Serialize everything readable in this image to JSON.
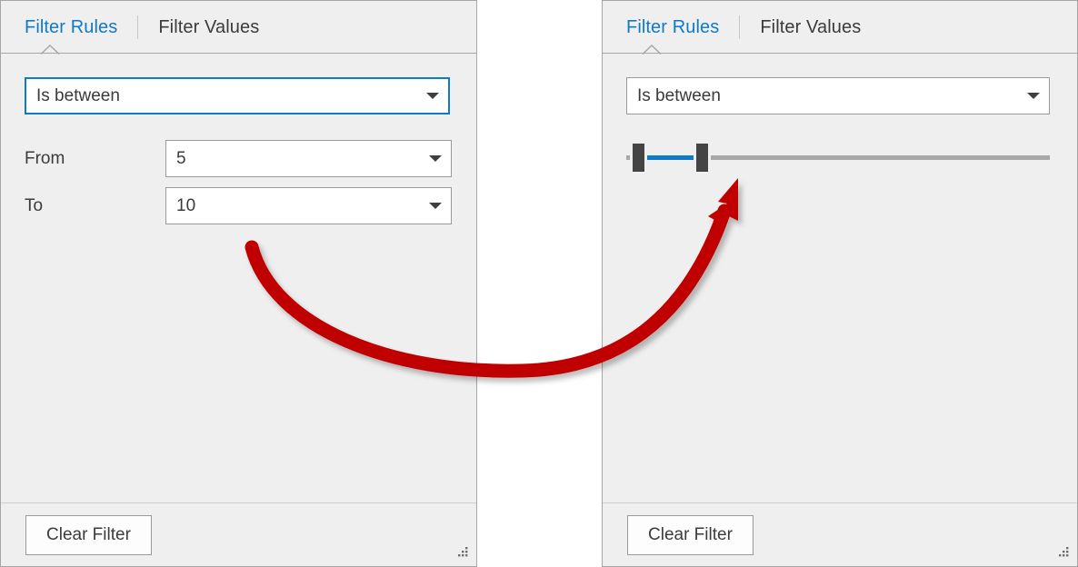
{
  "panels": [
    {
      "id": "left",
      "tabs": [
        {
          "label": "Filter Rules",
          "active": true
        },
        {
          "label": "Filter Values",
          "active": false
        }
      ],
      "rule_combo": {
        "value": "Is between",
        "focused": true
      },
      "fields": [
        {
          "label": "From",
          "value": "5"
        },
        {
          "label": "To",
          "value": "10"
        }
      ],
      "footer": {
        "clear_label": "Clear Filter"
      }
    },
    {
      "id": "right",
      "tabs": [
        {
          "label": "Filter Rules",
          "active": true
        },
        {
          "label": "Filter Values",
          "active": false
        }
      ],
      "rule_combo": {
        "value": "Is between",
        "focused": false
      },
      "slider": {
        "min": 0,
        "max": 100,
        "low": 3,
        "high": 18,
        "selected_color": "#0f7ac7",
        "track_color": "#a8a8a8",
        "thumb_color": "#444444"
      },
      "footer": {
        "clear_label": "Clear Filter"
      }
    }
  ],
  "annotation": {
    "arrow_color": "#c00000",
    "shadow_color": "rgba(0,0,0,0.22)"
  },
  "colors": {
    "accent_blue": "#0f7ac7",
    "panel_bg": "#efefef",
    "panel_border": "#a6a6a6",
    "text": "#3b3b3b",
    "field_bg": "#ffffff",
    "field_border": "#9a9a9a"
  }
}
